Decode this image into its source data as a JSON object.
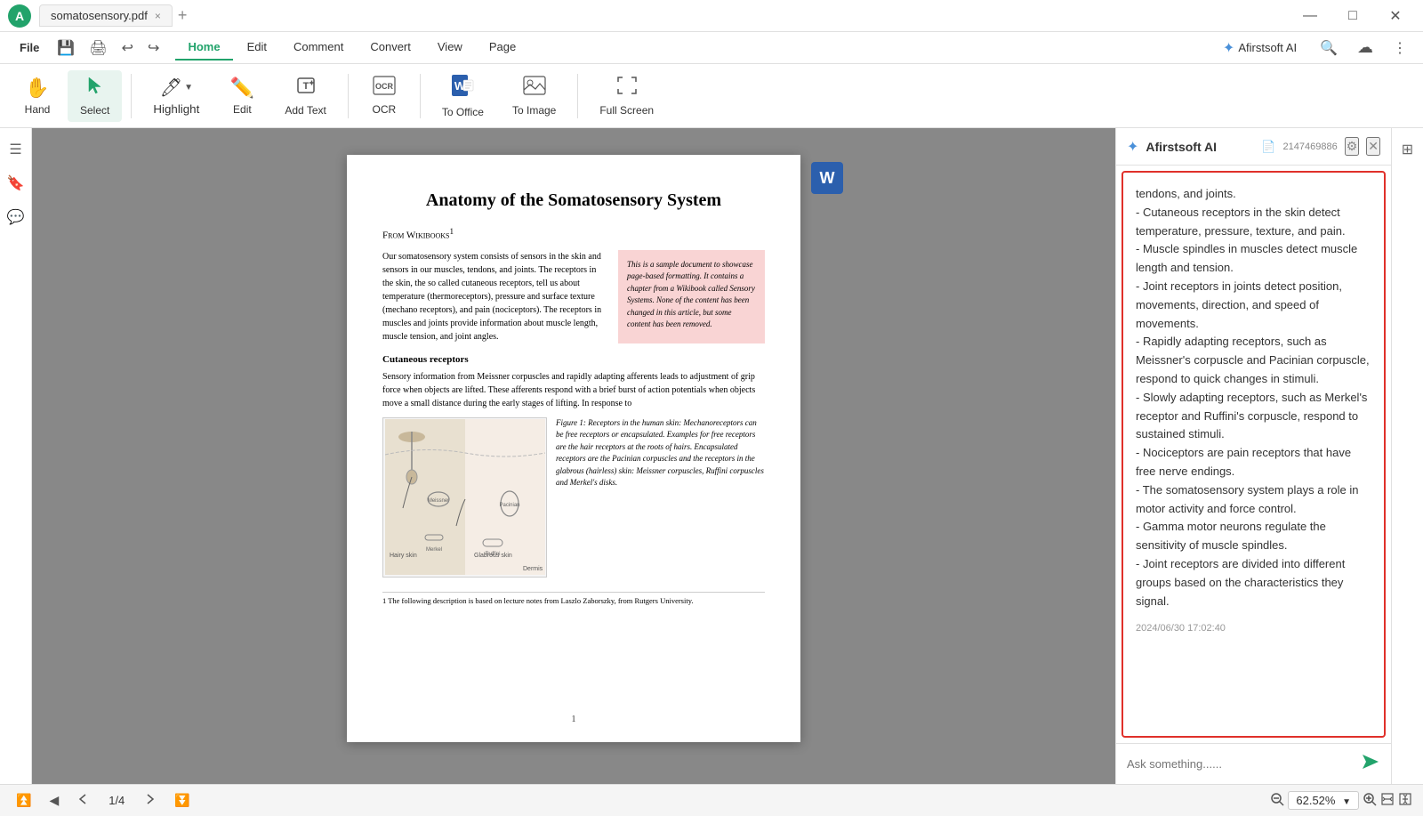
{
  "titlebar": {
    "logo_alt": "Afirstsoft Logo",
    "tab_name": "somatosensory.pdf",
    "tab_close": "×",
    "tab_add": "+",
    "controls": {
      "minimize": "—",
      "maximize": "□",
      "close": "✕"
    }
  },
  "menubar": {
    "file_label": "File",
    "nav_items": [
      {
        "label": "Home",
        "active": true
      },
      {
        "label": "Edit",
        "active": false
      },
      {
        "label": "Comment",
        "active": false
      },
      {
        "label": "Convert",
        "active": false
      },
      {
        "label": "View",
        "active": false
      },
      {
        "label": "Page",
        "active": false
      }
    ],
    "ai_label": "Afirstsoft AI",
    "save_tooltip": "Save",
    "print_tooltip": "Print",
    "undo_tooltip": "Undo",
    "redo_tooltip": "Redo"
  },
  "toolbar": {
    "tools": [
      {
        "name": "hand",
        "label": "Hand",
        "icon": "✋"
      },
      {
        "name": "select",
        "label": "Select",
        "icon": "↖",
        "active": true
      },
      {
        "name": "highlight",
        "label": "Highlight",
        "icon": "🖊",
        "has_arrow": true
      },
      {
        "name": "edit",
        "label": "Edit",
        "icon": "✏️"
      },
      {
        "name": "add_text",
        "label": "Add Text",
        "icon": "T"
      },
      {
        "name": "ocr",
        "label": "OCR",
        "icon": "⊡"
      },
      {
        "name": "to_office",
        "label": "To Office",
        "icon": "W"
      },
      {
        "name": "to_image",
        "label": "To Image",
        "icon": "🖼"
      },
      {
        "name": "full_screen",
        "label": "Full Screen",
        "icon": "⛶"
      }
    ]
  },
  "pdf": {
    "title": "Anatomy of the Somatosensory System",
    "from_line": "From Wikibooks",
    "footnote_ref": "1",
    "intro_text": "Our somatosensory system consists of sensors in the skin and sensors in our muscles, tendons, and joints. The receptors in the skin, the so called cutaneous receptors, tell us about temperature (thermoreceptors), pressure and surface texture (mechano receptors), and pain (nociceptors). The receptors in muscles and joints provide information about muscle length, muscle tension, and joint angles.",
    "pink_box_text": "This is a sample document to showcase page-based formatting. It contains a chapter from a Wikibook called Sensory Systems. None of the content has been changed in this article, but some content has been removed.",
    "section_cutaneous": "Cutaneous receptors",
    "cutaneous_text": "Sensory information from Meissner corpuscles and rapidly adapting afferents leads to adjustment of grip force when objects are lifted. These afferents respond with a brief burst of action potentials when objects move a small distance during the early stages of lifting. In response to",
    "figure_caption": "Figure 1: Receptors in the human skin: Mechanoreceptors can be free receptors or encapsulated. Examples for free receptors are the hair receptors at the roots of hairs. Encapsulated receptors are the Pacinian corpuscles and the receptors in the glabrous (hairless) skin: Meissner corpuscles, Ruffini corpuscles and Merkel's disks.",
    "footnote_text": "1 The following description is based on lecture notes from Laszlo Zaborszky, from Rutgers University.",
    "page_num": "1"
  },
  "ai_panel": {
    "title": "Afirstsoft AI",
    "doc_icon": "📄",
    "panel_id": "2147469886",
    "chat_content": [
      "tendons, and joints.",
      "- Cutaneous receptors in the skin detect temperature, pressure, texture, and pain.",
      "- Muscle spindles in muscles detect muscle length and tension.",
      "- Joint receptors in joints detect position, movements, direction, and speed of movements.",
      "- Rapidly adapting receptors, such as Meissner's corpuscle and Pacinian corpuscle, respond to quick changes in stimuli.",
      "- Slowly adapting receptors, such as Merkel's receptor and Ruffini's corpuscle, respond to sustained stimuli.",
      "- Nociceptors are pain receptors that have free nerve endings.",
      "- The somatosensory system plays a role in motor activity and force control.",
      "- Gamma motor neurons regulate the sensitivity of muscle spindles.",
      "- Joint receptors are divided into different groups based on the characteristics they signal."
    ],
    "timestamp": "2024/06/30 17:02:40",
    "input_placeholder": "Ask something......",
    "send_icon": "▶"
  },
  "bottombar": {
    "first_page_tip": "First Page",
    "prev_page_tip": "Previous Page",
    "page_display": "1/4",
    "next_page_tip": "Next Page",
    "last_page_tip": "Last Page",
    "zoom_out_tip": "Zoom Out",
    "zoom_value": "62.52%",
    "zoom_in_tip": "Zoom In",
    "fit_width_tip": "Fit Width",
    "fit_page_tip": "Fit Page"
  },
  "sidebar": {
    "icons": [
      "☰",
      "🔖",
      "💬"
    ]
  }
}
